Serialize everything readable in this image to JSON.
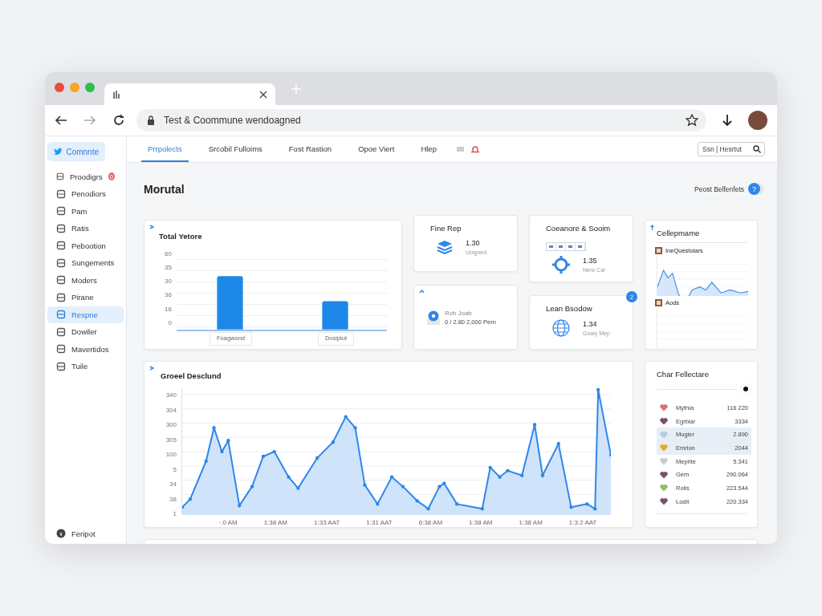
{
  "browser": {
    "address": "Test & Coommune wendoagned"
  },
  "sidebar": {
    "header": "Comnnte",
    "items": [
      {
        "label": "Proodigrs",
        "selected": false,
        "badge": "0"
      },
      {
        "label": "Penodiors",
        "selected": false
      },
      {
        "label": "Pam",
        "selected": false
      },
      {
        "label": "Ratis",
        "selected": false
      },
      {
        "label": "Pebootion",
        "selected": false
      },
      {
        "label": "Sungements",
        "selected": false
      },
      {
        "label": "Moders",
        "selected": false
      },
      {
        "label": "Pirane",
        "selected": false
      },
      {
        "label": "Respne",
        "selected": true
      },
      {
        "label": "Dowiler",
        "selected": false
      },
      {
        "label": "Mavertidos",
        "selected": false
      },
      {
        "label": "Tuile",
        "selected": false
      }
    ],
    "footer": "Feripot"
  },
  "nav": {
    "tabs": [
      {
        "label": "Prrpolects",
        "selected": true
      },
      {
        "label": "Srcobil Fulloims",
        "selected": false
      },
      {
        "label": "Fost Rastion",
        "selected": false
      },
      {
        "label": "Opoe Viert",
        "selected": false
      },
      {
        "label": "Hlep",
        "selected": false
      }
    ],
    "search": {
      "placeholder": "Ssn | Hesrtut"
    }
  },
  "page": {
    "title": "Morutal",
    "action": {
      "label": "Peost Belfenfets",
      "badge": "?"
    }
  },
  "bar_card": {
    "title": "Total Yetore",
    "yticks": [
      "60",
      "35",
      "30",
      "36",
      "16",
      "0"
    ],
    "bars": [
      {
        "label": "Foagwond"
      },
      {
        "label": "Dosipiut"
      }
    ]
  },
  "stats": [
    {
      "title": "Fine Rep",
      "value": "1.30",
      "caption": "Uoigned",
      "kind": "layers"
    },
    {
      "title": "Coeanore & Sooim",
      "value": "1.35",
      "caption": "Nere Car",
      "kind": "gear"
    },
    {
      "title": "Rvb Joab",
      "value": "0 / 2.80 2,000 Pern",
      "kind": "pin"
    },
    {
      "title": "Lean Bsodow",
      "value": "1.34",
      "caption": "Goaly Mep",
      "kind": "globe",
      "badge": "2"
    }
  ],
  "mini_card": {
    "title": "Cellepmame",
    "panels": [
      {
        "label": "IneQuestoiars"
      },
      {
        "label": "Aods"
      }
    ]
  },
  "line_card": {
    "title": "Groeel Desclund",
    "yticks": [
      "340",
      "304",
      "300",
      "305",
      "100",
      "5",
      "34",
      "38",
      "1"
    ],
    "xticks": [
      "·.0 AM",
      "1:38 AM",
      "1:33 AAT",
      "1:31 AAT",
      "6:38 AM",
      "1:38 AM",
      "1:38 AM",
      "1:3:2 AAT"
    ]
  },
  "list_card": {
    "title": "Char Fellectare",
    "items": [
      {
        "name": "Mythia",
        "value": "116 220",
        "color": "#d9707a",
        "selected": false
      },
      {
        "name": "Egrbiar",
        "value": "3334",
        "color": "#7a4f6e",
        "selected": false
      },
      {
        "name": "Mugier",
        "value": "2.890",
        "color": "#b7cbe0",
        "selected": true
      },
      {
        "name": "Emrlon",
        "value": "2044",
        "color": "#e0b020",
        "selected": true
      },
      {
        "name": "Meprite",
        "value": "5.341",
        "color": "#c8c8d8",
        "selected": false
      },
      {
        "name": "Gem",
        "value": "290.064",
        "color": "#7a4f6e",
        "selected": false
      },
      {
        "name": "Rolis",
        "value": "223.544",
        "color": "#8cc070",
        "selected": false
      },
      {
        "name": "Lodit",
        "value": "220.334",
        "color": "#7a4f6e",
        "selected": false
      }
    ]
  }
}
